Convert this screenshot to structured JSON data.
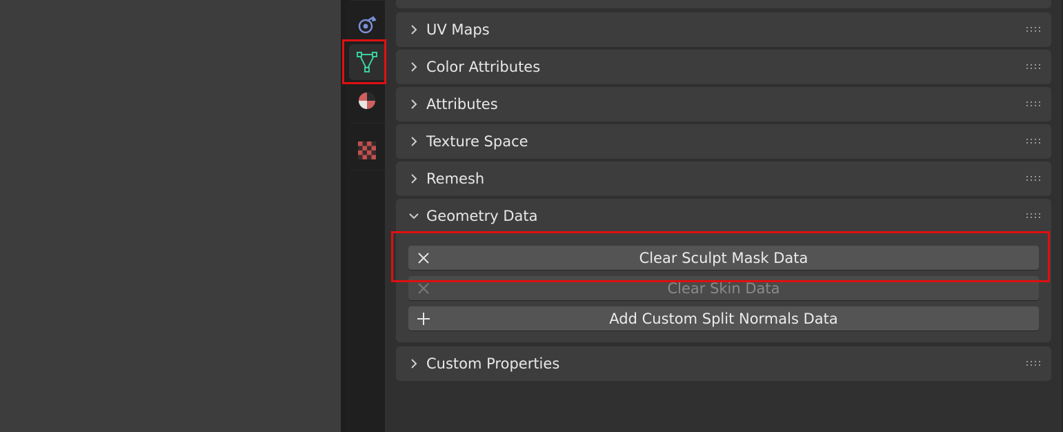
{
  "colors": {
    "highlight": "#e01010",
    "data_tab_icon": "#3ad0a0",
    "physics_icon": "#7a90d8",
    "material_icon": "#d06060",
    "texture_icon": "#c05050"
  },
  "tabs": [
    {
      "name": "physics-tab",
      "icon": "physics-icon"
    },
    {
      "name": "object-data-tab",
      "icon": "mesh-data-icon",
      "active": true
    },
    {
      "name": "material-tab",
      "icon": "material-icon"
    },
    {
      "name": "texture-tab",
      "icon": "texture-icon"
    }
  ],
  "panels": {
    "uv_maps": {
      "title": "UV Maps",
      "expanded": false
    },
    "color_attributes": {
      "title": "Color Attributes",
      "expanded": false
    },
    "attributes": {
      "title": "Attributes",
      "expanded": false
    },
    "texture_space": {
      "title": "Texture Space",
      "expanded": false
    },
    "remesh": {
      "title": "Remesh",
      "expanded": false
    },
    "geometry_data": {
      "title": "Geometry Data",
      "expanded": true,
      "buttons": {
        "clear_sculpt_mask": {
          "label": "Clear Sculpt Mask Data",
          "icon": "x-icon",
          "enabled": true
        },
        "clear_skin": {
          "label": "Clear Skin Data",
          "icon": "x-icon",
          "enabled": false
        },
        "add_custom_split_normals": {
          "label": "Add Custom Split Normals Data",
          "icon": "plus-icon",
          "enabled": true
        }
      }
    },
    "custom_properties": {
      "title": "Custom Properties",
      "expanded": false
    }
  }
}
